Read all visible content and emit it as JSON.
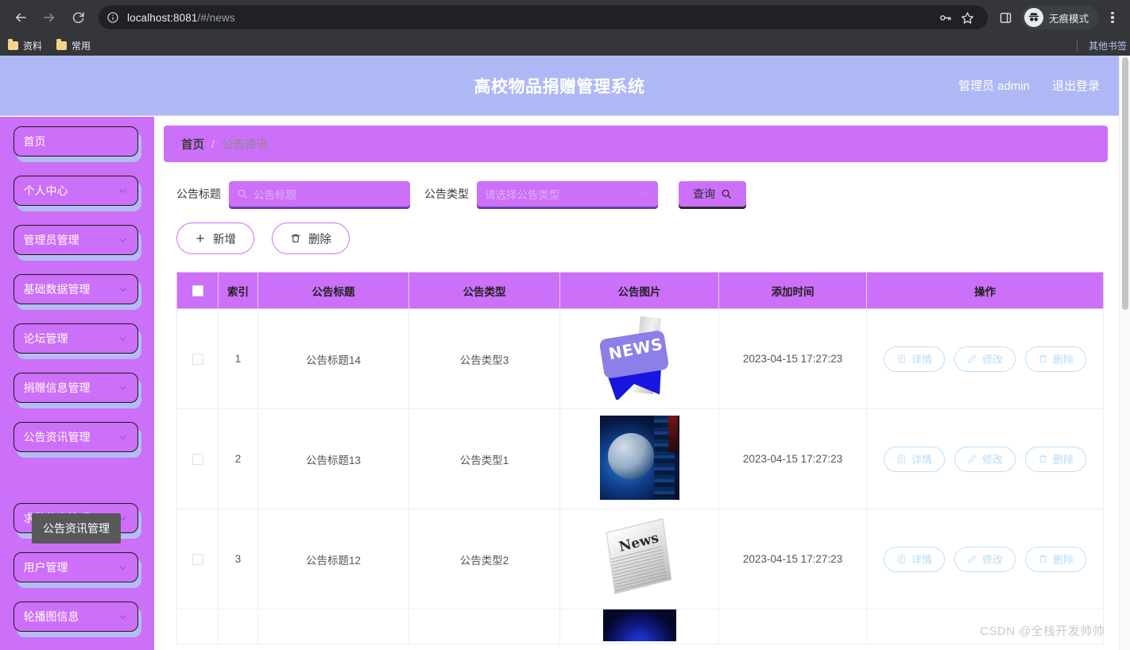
{
  "browser": {
    "back_icon": "back-arrow-icon",
    "forward_icon": "forward-arrow-icon",
    "reload_icon": "reload-icon",
    "site_info_icon": "info-circle-icon",
    "url_host": "localhost:8081",
    "url_path": "/#/news",
    "password_icon": "key-icon",
    "bookmark_icon": "star-icon",
    "sidepanel_icon": "side-panel-icon",
    "incognito_label": "无痕模式",
    "menu_icon": "three-dots-icon",
    "bookmarks": [
      {
        "label": "资料"
      },
      {
        "label": "常用"
      }
    ],
    "other_bookmarks_label": "其他书签"
  },
  "header": {
    "title": "高校物品捐赠管理系统",
    "user_label": "管理员 admin",
    "logout_label": "退出登录",
    "bg_color": "#aeb8f5"
  },
  "sidebar": {
    "bg_color": "#cc6ff9",
    "items": [
      {
        "label": "首页",
        "has_chevron": false
      },
      {
        "label": "个人中心",
        "has_chevron": true
      },
      {
        "label": "管理员管理",
        "has_chevron": true
      },
      {
        "label": "基础数据管理",
        "has_chevron": true
      },
      {
        "label": "论坛管理",
        "has_chevron": true
      },
      {
        "label": "捐赠信息管理",
        "has_chevron": true
      },
      {
        "label": "公告资讯管理",
        "has_chevron": true
      },
      {
        "label": "求助信息管理",
        "has_chevron": true
      },
      {
        "label": "用户管理",
        "has_chevron": true
      },
      {
        "label": "轮播图信息",
        "has_chevron": true
      }
    ],
    "tooltip": "公告资讯管理"
  },
  "breadcrumb": {
    "home": "首页",
    "separator": "/",
    "current": "公告资讯"
  },
  "filters": {
    "title_label": "公告标题",
    "title_placeholder": "公告标题",
    "title_value": "",
    "type_label": "公告类型",
    "type_placeholder": "请选择公告类型",
    "type_value": "",
    "search_label": "查询",
    "search_icon": "magnifier-icon"
  },
  "actions": {
    "add_label": "新增",
    "add_icon": "plus-icon",
    "delete_label": "删除",
    "delete_icon": "trash-icon"
  },
  "table": {
    "columns": [
      "",
      "索引",
      "公告标题",
      "公告类型",
      "公告图片",
      "添加时间",
      "操作"
    ],
    "header_checkbox_checked": false,
    "rows": [
      {
        "checked": false,
        "index": "1",
        "title": "公告标题14",
        "type": "公告类型3",
        "image": "news-tag-thumbnail",
        "image_text": "NEWS",
        "time": "2023-04-15 17:27:23"
      },
      {
        "checked": false,
        "index": "2",
        "title": "公告标题13",
        "type": "公告类型1",
        "image": "globe-thumbnail",
        "image_text": "",
        "time": "2023-04-15 17:27:23"
      },
      {
        "checked": false,
        "index": "3",
        "title": "公告标题12",
        "type": "公告类型2",
        "image": "newspaper-thumbnail",
        "image_text": "News",
        "time": "2023-04-15 17:27:23"
      },
      {
        "checked": false,
        "index": "",
        "title": "",
        "type": "",
        "image": "dark-blue-thumbnail",
        "image_text": "",
        "time": ""
      }
    ],
    "row_actions": {
      "detail_label": "详情",
      "detail_icon": "document-icon",
      "edit_label": "修改",
      "edit_icon": "pencil-icon",
      "delete_label": "删除",
      "delete_icon": "trash-icon"
    }
  },
  "watermark": "CSDN @全栈开发帅帅"
}
